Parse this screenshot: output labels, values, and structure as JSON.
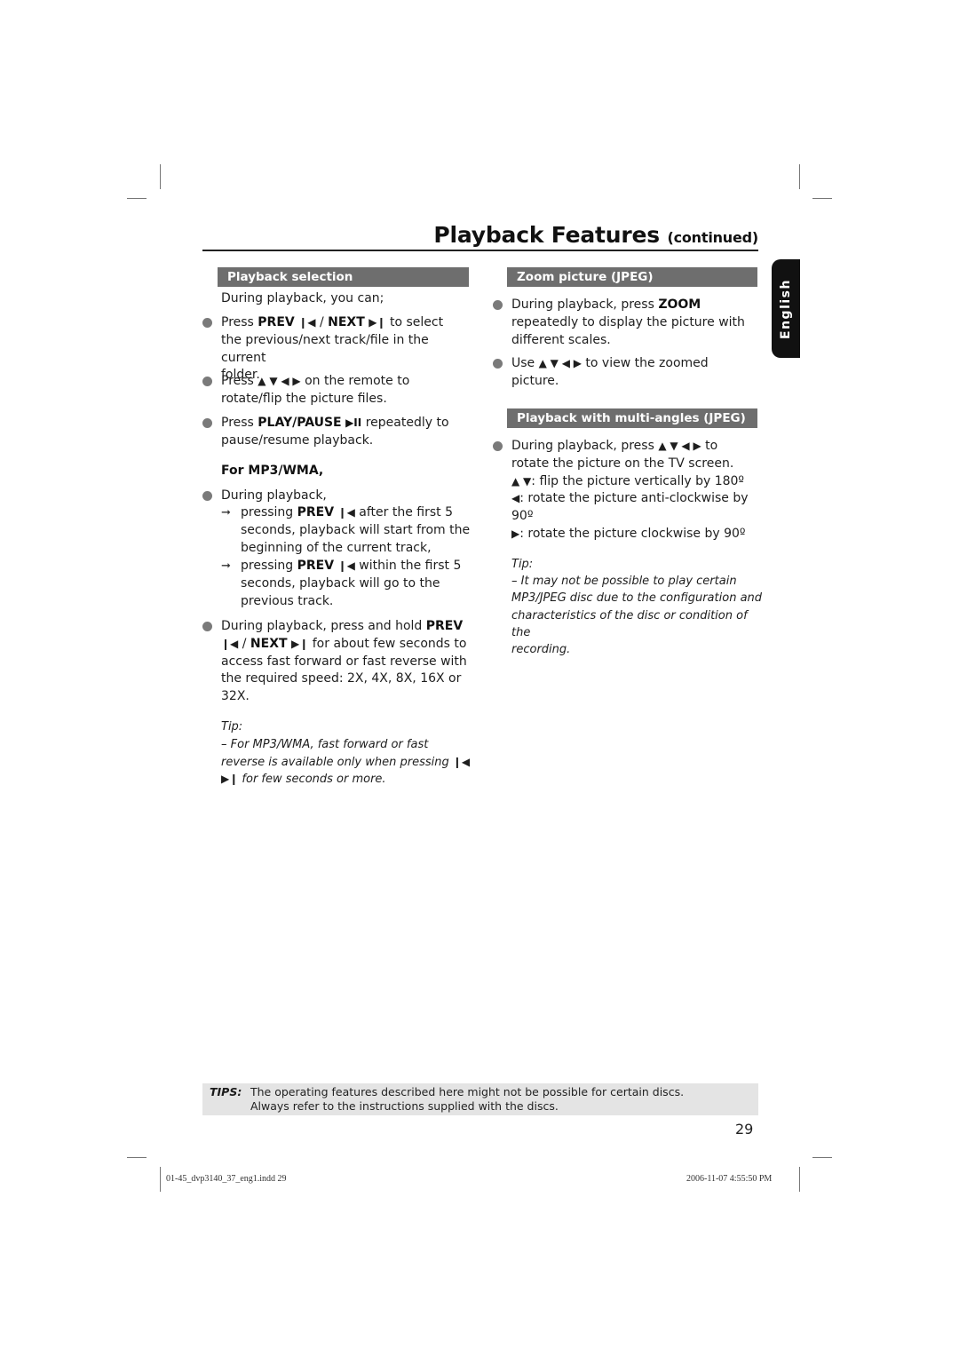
{
  "header": {
    "title": "Playback Features",
    "title_suffix": "(continued)"
  },
  "language_tab": "English",
  "left_column": {
    "section_title": "Playback selection",
    "intro": "During playback, you can;",
    "bullets": [
      {
        "line1_pre": "Press ",
        "line1_bold1": "PREV",
        "line1_icon1": "❙◀",
        "line1_sep": " / ",
        "line1_bold2": "NEXT",
        "line1_icon2": "▶❙",
        "line1_post": " to select",
        "line2": "the previous/next track/file in the current",
        "line3": "folder."
      },
      {
        "line1_pre": "Press ",
        "line1_icons": "▲ ▼ ◀ ▶",
        "line1_post": " on the remote to",
        "line2": "rotate/flip the picture files."
      },
      {
        "line1_pre": "Press ",
        "line1_bold": "PLAY/PAUSE",
        "line1_icon": "▶II",
        "line1_post": " repeatedly to",
        "line2": "pause/resume playback."
      }
    ],
    "subheading": "For MP3/WMA,",
    "mp3_bullet": "During playback,",
    "mp3_results": [
      {
        "line1_pre": "pressing ",
        "line1_bold": "PREV",
        "line1_icon": "❙◀",
        "line1_post": " after the first 5",
        "line2": "seconds, playback will start from the",
        "line3": "beginning of the current track,"
      },
      {
        "line1_pre": "pressing ",
        "line1_bold": "PREV",
        "line1_icon": "❙◀",
        "line1_post": " within the first 5",
        "line2": "seconds, playback will go to the",
        "line3": "previous track."
      }
    ],
    "hold_bullet": {
      "line1_pre": "During playback, press and hold ",
      "line1_bold": "PREV",
      "line2_icon1": "❙◀",
      "line2_sep": " / ",
      "line2_bold": "NEXT",
      "line2_icon2": "▶❙",
      "line2_post": " for about few seconds to",
      "line3": "access fast forward or fast reverse with",
      "line4": "the required speed: 2X, 4X, 8X, 16X or",
      "line5": "32X."
    },
    "tip": {
      "label": "Tip:",
      "line1": "– For MP3/WMA, fast forward or fast",
      "line2_pre": "reverse is available only when pressing ",
      "line2_icon": "❙◀",
      "line3_icon": "▶❙",
      "line3_post": " for few seconds or more."
    }
  },
  "right_column": {
    "zoom_section": {
      "title": "Zoom picture (JPEG)",
      "bullet1_pre": "During playback, press ",
      "bullet1_bold": "ZOOM",
      "bullet1_line2": "repeatedly to display the picture with",
      "bullet1_line3": "different scales.",
      "bullet2_pre": "Use ",
      "bullet2_icons": "▲ ▼ ◀ ▶",
      "bullet2_post": " to view the zoomed",
      "bullet2_line2": "picture."
    },
    "angles_section": {
      "title": "Playback with multi-angles (JPEG)",
      "line1_pre": "During playback, press ",
      "line1_icons": "▲ ▼ ◀ ▶",
      "line1_post": " to",
      "line2": "rotate the picture on the TV screen.",
      "line3_icons": "▲ ▼",
      "line3_post": ": flip the picture vertically by 180º",
      "line4_icon": "◀",
      "line4_post": ": rotate the picture anti-clockwise by",
      "line5": "90º",
      "line6_icon": "▶",
      "line6_post": ": rotate the picture clockwise by 90º"
    },
    "tip": {
      "label": "Tip:",
      "line1": "–  It may not be possible to play certain",
      "line2": "MP3/JPEG disc due to the configuration and",
      "line3": "characteristics of the disc or condition of the",
      "line4": "recording."
    }
  },
  "footer_tips": {
    "label": "TIPS:",
    "line1": "The operating features described here might not be possible for certain discs.",
    "line2": "Always refer to the instructions supplied with the discs."
  },
  "page_number": "29",
  "slug": {
    "file": "01-45_dvp3140_37_eng1.indd   29",
    "timestamp": "2006-11-07   4:55:50 PM"
  }
}
